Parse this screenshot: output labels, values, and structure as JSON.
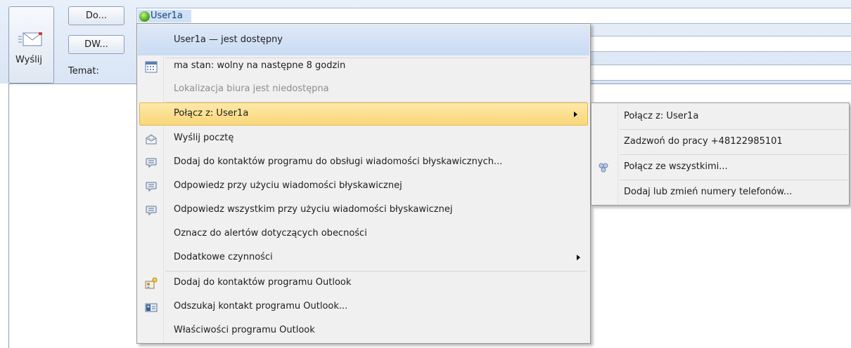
{
  "compose": {
    "send_label": "Wyślij",
    "to_button": "Do...",
    "cc_button": "DW...",
    "subject_label": "Temat:",
    "to_recipient": "User1a"
  },
  "context_menu": {
    "header": "User1a — jest dostępny",
    "items": [
      {
        "label": "ma stan: wolny na następne 8 godzin",
        "icon": "calendar-icon",
        "disabled": false
      },
      {
        "label": "Lokalizacja biura jest niedostępna",
        "icon": "",
        "disabled": true
      },
      {
        "label": "Połącz z: User1a",
        "icon": "",
        "submenu": true,
        "highlighted": true
      },
      {
        "label": "Wyślij pocztę",
        "icon": "send-mail-icon"
      },
      {
        "label": "Dodaj do kontaktów programu do obsługi wiadomości błyskawicznych...",
        "icon": "im-bubble-icon"
      },
      {
        "label": "Odpowiedz przy użyciu wiadomości błyskawicznej",
        "icon": "im-bubble-icon"
      },
      {
        "label": "Odpowiedz wszystkim przy użyciu wiadomości błyskawicznej",
        "icon": "im-bubble-icon"
      },
      {
        "label": "Oznacz do alertów dotyczących obecności",
        "icon": ""
      },
      {
        "label": "Dodatkowe czynności",
        "icon": "",
        "submenu": true
      },
      {
        "label": "Dodaj do kontaktów programu Outlook",
        "icon": "add-contact-icon"
      },
      {
        "label": "Odszukaj kontakt programu Outlook...",
        "icon": "contact-card-icon"
      },
      {
        "label": "Właściwości programu Outlook",
        "icon": ""
      }
    ]
  },
  "submenu": {
    "items": [
      {
        "label": "Połącz z: User1a",
        "icon": ""
      },
      {
        "label": "Zadzwoń do pracy +48122985101",
        "icon": ""
      },
      {
        "label": "Połącz ze wszystkimi...",
        "icon": "conference-icon"
      },
      {
        "label": "Dodaj lub zmień numery telefonów...",
        "icon": ""
      }
    ]
  },
  "colors": {
    "header_bg": "#dfe8f6",
    "highlight": "#fbe19a",
    "presence_green": "#4aa81e"
  }
}
